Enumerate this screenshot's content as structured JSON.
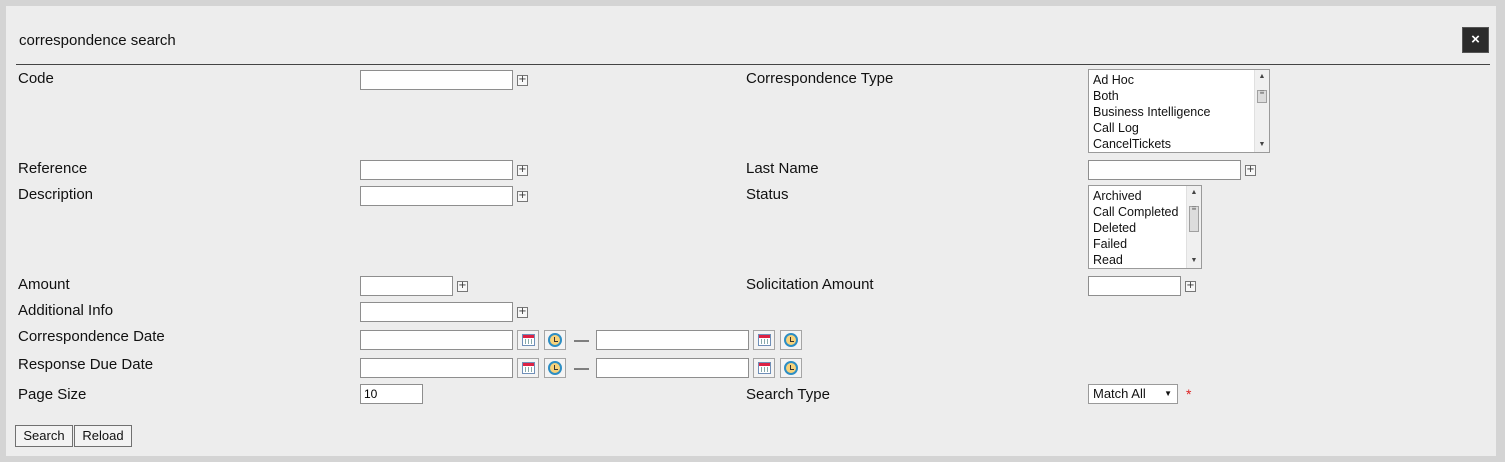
{
  "dialog": {
    "title": "correspondence search",
    "close_label": "×"
  },
  "fields": {
    "code": {
      "label": "Code",
      "value": ""
    },
    "correspondence_type": {
      "label": "Correspondence Type",
      "options": [
        "Ad Hoc",
        "Both",
        "Business Intelligence",
        "Call Log",
        "CancelTickets"
      ]
    },
    "reference": {
      "label": "Reference",
      "value": ""
    },
    "last_name": {
      "label": "Last Name",
      "value": ""
    },
    "description": {
      "label": "Description",
      "value": ""
    },
    "status": {
      "label": "Status",
      "options": [
        "Archived",
        "Call Completed",
        "Deleted",
        "Failed",
        "Read"
      ]
    },
    "amount": {
      "label": "Amount",
      "value": ""
    },
    "solicitation_amount": {
      "label": "Solicitation Amount",
      "value": ""
    },
    "additional_info": {
      "label": "Additional Info",
      "value": ""
    },
    "correspondence_date": {
      "label": "Correspondence Date",
      "from": "",
      "to": "",
      "separator": "—"
    },
    "response_due_date": {
      "label": "Response Due Date",
      "from": "",
      "to": "",
      "separator": "—"
    },
    "page_size": {
      "label": "Page Size",
      "value": "10"
    },
    "search_type": {
      "label": "Search Type",
      "value": "Match All",
      "required_marker": "*"
    }
  },
  "icons": {
    "expand": "plus-box-icon",
    "calendar": "calendar-icon",
    "clock": "clock-icon"
  },
  "buttons": {
    "search": "Search",
    "reload": "Reload"
  }
}
